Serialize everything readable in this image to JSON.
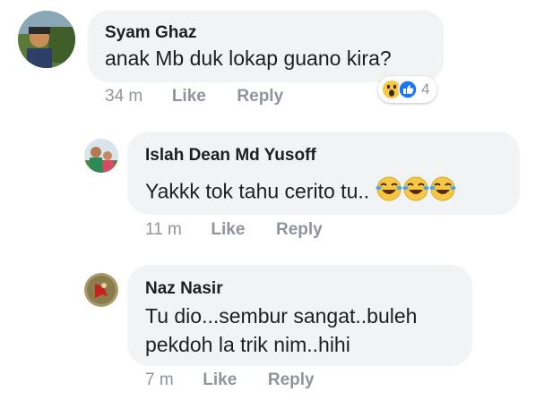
{
  "comments": [
    {
      "author": "Syam Ghaz",
      "text": "anak Mb duk lokap guano kira?",
      "time": "34 m",
      "like_label": "Like",
      "reply_label": "Reply",
      "reaction_count": "4",
      "reaction_icons": [
        "wow-icon",
        "like-icon"
      ]
    },
    {
      "author": "Islah Dean Md Yusoff",
      "text": "Yakkk tok tahu cerito tu..",
      "emoji": [
        "laughing-crying-emoji",
        "laughing-crying-emoji",
        "laughing-crying-emoji"
      ],
      "time": "11 m",
      "like_label": "Like",
      "reply_label": "Reply"
    },
    {
      "author": "Naz Nasir",
      "text_line1": "Tu dio...sembur sangat..buleh",
      "text_line2": "pekdoh la trik nim..hihi",
      "time": "7 m",
      "like_label": "Like",
      "reply_label": "Reply"
    }
  ],
  "colors": {
    "bubble": "#f2f3f5",
    "meta_text": "#90949c",
    "like_blue": "#1877f2",
    "wow_yellow": "#f7c844"
  }
}
